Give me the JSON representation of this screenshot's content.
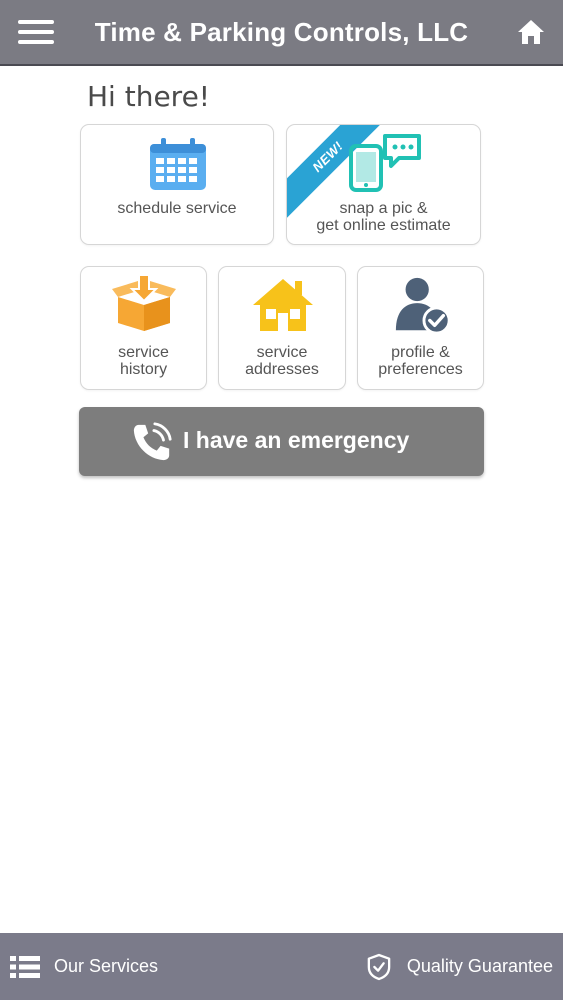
{
  "header": {
    "title": "Time & Parking Controls, LLC",
    "menu_icon": "hamburger-menu-icon",
    "home_icon": "home-icon",
    "background": "#7b7b83"
  },
  "main": {
    "greeting": "Hi there!",
    "tiles": {
      "schedule": {
        "label": "schedule service",
        "icon": "calendar-icon",
        "icon_color": "#5aaef0"
      },
      "snap": {
        "line1": "snap a pic &",
        "line2": "get online estimate",
        "badge": "NEW!",
        "badge_color": "#2aa3d4",
        "icon": "phone-chat-icon",
        "icon_color": "#21c1b4"
      },
      "history": {
        "line1": "service",
        "line2": "history",
        "icon": "box-download-icon",
        "icon_color": "#f6a734"
      },
      "addresses": {
        "line1": "service",
        "line2": "addresses",
        "icon": "house-icon",
        "icon_color": "#f7c21a"
      },
      "profile": {
        "line1": "profile &",
        "line2": "preferences",
        "icon": "user-check-icon",
        "icon_color": "#4e6178"
      }
    },
    "emergency": {
      "label": "I have an emergency",
      "icon": "phone-ringing-icon",
      "background": "#7d7d7d"
    }
  },
  "footer": {
    "services_label": "Our Services",
    "services_icon": "list-icon",
    "quality_label": "Quality Guarantee",
    "quality_icon": "shield-check-icon"
  }
}
